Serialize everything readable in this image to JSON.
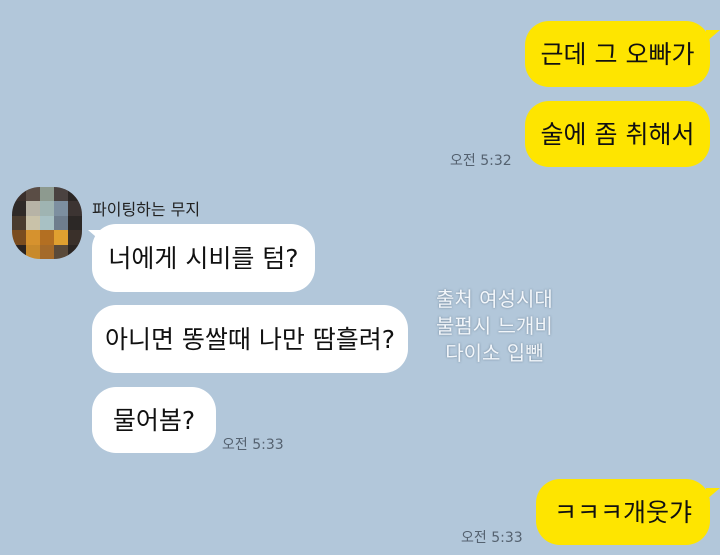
{
  "chat": {
    "sender_name": "파이팅하는 무지",
    "messages_mine_top": [
      "근데 그 오빠가",
      "술에 좀 취해서"
    ],
    "time_mine_top": "오전 5:32",
    "messages_theirs": [
      "너에게 시비를 텀?",
      "아니면 똥쌀때 나만 땀흘려?",
      "물어봄?"
    ],
    "time_theirs": "오전 5:33",
    "messages_mine_bottom": [
      "ㅋㅋㅋ개웃갸"
    ],
    "time_mine_bottom": "오전 5:33"
  },
  "watermark": {
    "line1": "출처 여성시대",
    "line2": "불펌시 느개비",
    "line3": "다이소 입뺀"
  },
  "colors": {
    "background": "#b2c7da",
    "my_bubble": "#fee500",
    "their_bubble": "#ffffff"
  },
  "icons": {
    "avatar": "pixelated-profile-avatar"
  }
}
